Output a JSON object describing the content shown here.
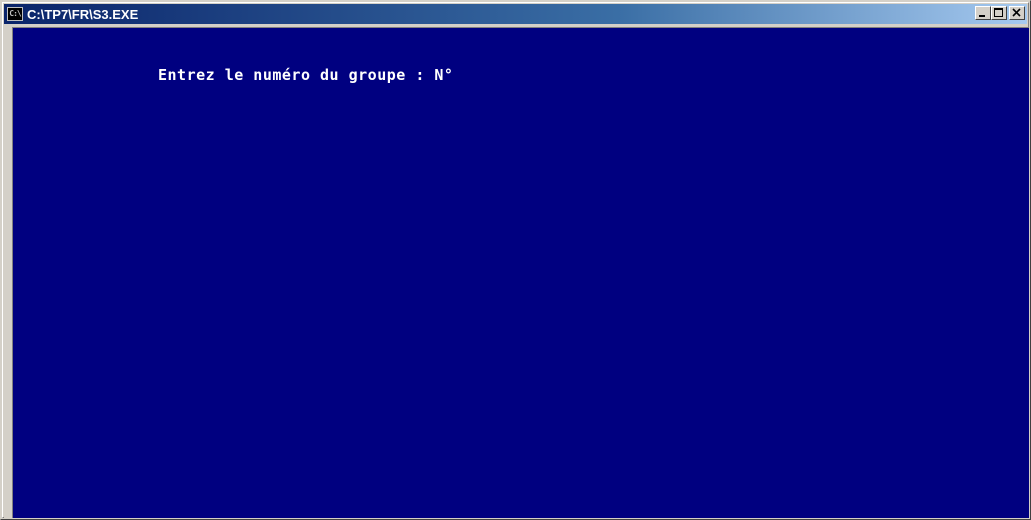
{
  "window": {
    "title": "C:\\TP7\\FR\\S3.EXE",
    "icon_label": "C:\\"
  },
  "title_buttons": {
    "minimize": "minimize-icon",
    "maximize": "maximize-icon",
    "close": "close-icon"
  },
  "console": {
    "prompt": "Entrez le numéro du groupe : N°"
  },
  "colors": {
    "console_background": "#000080",
    "console_text": "#ffffff",
    "titlebar_start": "#0a246a",
    "titlebar_end": "#a6caf0"
  }
}
